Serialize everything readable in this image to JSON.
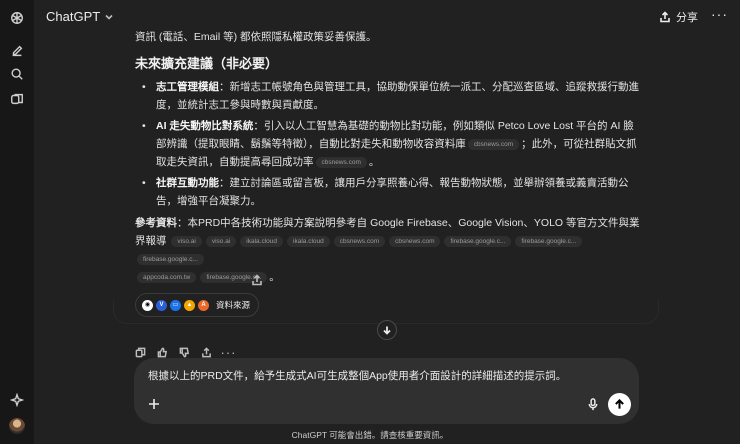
{
  "app": {
    "model_label": "ChatGPT",
    "share_label": "分享",
    "kebab_label": "···"
  },
  "message": {
    "line_top": "資訊 (電話、Email 等) 都依照隱私權政策妥善保護。",
    "section_title": "未來擴充建議（非必要）",
    "items": [
      {
        "title": "志工管理模組",
        "text": "：新增志工帳號角色與管理工具，協助動保單位統一派工、分配巡查區域、追蹤救援行動進度，並統計志工參與時數與貢獻度。"
      },
      {
        "title": "AI 走失動物比對系統",
        "text_a": "：引入以人工智慧為基礎的動物比對功能，例如類似 Petco Love Lost 平台的 AI 臉部辨識（提取眼睛、鬍鬚等特徵），自動比對走失和動物收容資料庫",
        "chip_a": "cbsnews.com",
        "text_b": "；此外，可從社群貼文抓取走失資訊，自動提高尋回成功率",
        "chip_b": "cbsnews.com",
        "text_c": "。"
      },
      {
        "title": "社群互動功能",
        "text": "：建立討論區或留言板，讓用戶分享照養心得、報告動物狀態，並舉辦領養或義賣活動公告，增強平台凝聚力。"
      }
    ],
    "refs_title": "參考資料",
    "refs_text": "：本PRD中各技術功能與方案說明參考自 Google Firebase、Google Vision、YOLO 等官方文件與業界報導",
    "ref_chips_row1": [
      "viso.ai",
      "viso.ai",
      "ikala.cloud",
      "ikala.cloud",
      "cbsnews.com",
      "cbsnews.com",
      "firebase.google.c...",
      "firebase.google.c...",
      "firebase.google.c..."
    ],
    "ref_chips_row2": [
      "appcoda.com.tw",
      "firebase.google.c..."
    ],
    "ref_end": "。",
    "sources_label": "資料來源",
    "source_icons": [
      "V",
      "▭",
      "A"
    ]
  },
  "composer": {
    "prompt_text": "根據以上的PRD文件，給予生成式AI可生成整個App使用者介面設計的詳細描述的提示詞。"
  },
  "disclaimer": "ChatGPT 可能會出錯。請查核重要資訊。",
  "colors": {
    "background": "#212121",
    "sidebar": "#171717",
    "composer": "#303030",
    "chip_bg": "#2f2f2f",
    "send_button": "#ffffff"
  }
}
